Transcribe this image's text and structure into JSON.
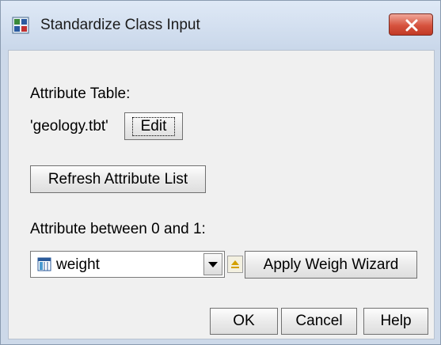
{
  "window": {
    "title": "Standardize Class Input",
    "close_icon": "close-x-icon",
    "app_icon": "grid-app-icon"
  },
  "attribute_table": {
    "label": "Attribute Table:",
    "value": "'geology.tbt'",
    "edit_label": "Edit"
  },
  "refresh_label": "Refresh Attribute List",
  "attribute": {
    "label": "Attribute between 0 and 1:",
    "selected": "weight",
    "apply_label": "Apply Weigh Wizard"
  },
  "footer": {
    "ok_label": "OK",
    "cancel_label": "Cancel",
    "help_label": "Help"
  },
  "colors": {
    "titlebar": "#c9d7ea",
    "close": "#d6533e",
    "dialog_bg": "#f0f0f0"
  }
}
